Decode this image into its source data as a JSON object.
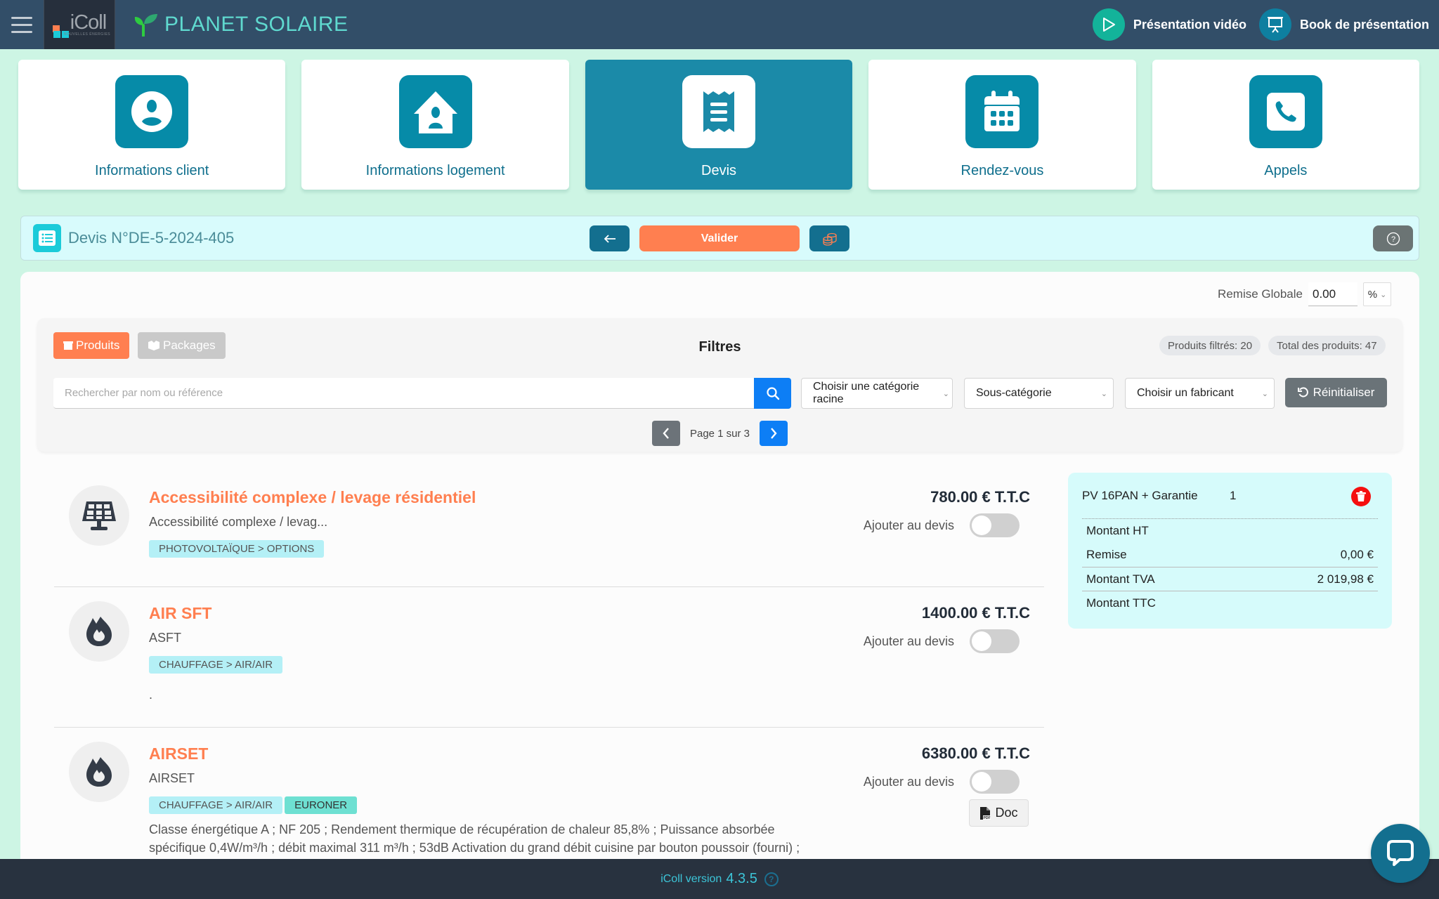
{
  "topbar": {
    "logo_text": "iColl",
    "logo_sub": "NOUVELLES ÉNERGIES",
    "brand_name": "PLANET SOLAIRE",
    "actions": [
      {
        "label": "Présentation vidéo",
        "icon": "play-icon",
        "color": "#13b39a"
      },
      {
        "label": "Book de présentation",
        "icon": "presentation-board-icon",
        "color": "#0e7fa0"
      }
    ]
  },
  "tiles": [
    {
      "label": "Informations client",
      "icon": "user-circle-icon",
      "active": false
    },
    {
      "label": "Informations logement",
      "icon": "house-user-icon",
      "active": false
    },
    {
      "label": "Devis",
      "icon": "receipt-icon",
      "active": true
    },
    {
      "label": "Rendez-vous",
      "icon": "calendar-icon",
      "active": false
    },
    {
      "label": "Appels",
      "icon": "phone-icon",
      "active": false
    }
  ],
  "devis_bar": {
    "title": "Devis N°DE-5-2024-405",
    "valider_label": "Valider",
    "back_icon": "arrow-left-icon",
    "coins_icon": "coins-icon",
    "help_icon": "question-circle-icon"
  },
  "remise": {
    "label": "Remise Globale",
    "value": "0.00",
    "unit": "%"
  },
  "filters": {
    "title": "Filtres",
    "tabs": [
      {
        "label": "Produits",
        "active": true
      },
      {
        "label": "Packages",
        "active": false
      }
    ],
    "filtered_count": "Produits filtrés: 20",
    "total_count": "Total des produits: 47",
    "search_placeholder": "Rechercher par nom ou référence",
    "search_value": "",
    "category_select": "Choisir une catégorie racine",
    "subcategory_select": "Sous-catégorie",
    "manufacturer_select": "Choisir un fabricant",
    "reset_label": "Réinitialiser",
    "pagination": {
      "text": "Page 1 sur 3",
      "current": 1,
      "total": 3
    }
  },
  "products": [
    {
      "name": "Accessibilité complexe / levage résidentiel",
      "ref": "Accessibilité complexe / levag...",
      "tags": [
        "PHOTOVOLTAÏQUE > OPTIONS"
      ],
      "brand": "",
      "description": "",
      "price": "780.00 € T.T.C",
      "add_label": "Ajouter au devis",
      "added": false,
      "icon": "solar-panel-icon",
      "has_doc": false
    },
    {
      "name": "AIR SFT",
      "ref": "ASFT",
      "tags": [
        "CHAUFFAGE > AIR/AIR"
      ],
      "brand": "",
      "description": ".",
      "price": "1400.00 € T.T.C",
      "add_label": "Ajouter au devis",
      "added": false,
      "icon": "fire-icon",
      "has_doc": false
    },
    {
      "name": "AIRSET",
      "ref": "AIRSET",
      "tags": [
        "CHAUFFAGE > AIR/AIR"
      ],
      "brand": "EURONER",
      "description": "Classe énergétique A ; NF 205 ; Rendement thermique de récupération de chaleur 85,8% ; Puissance absorbée spécifique 0,4W/m³/h ; débit maximal 311 m³/h ; 53dB Activation du grand débit cuisine par bouton poussoir (fourni) ; Caisson",
      "price": "6380.00 € T.T.C",
      "add_label": "Ajouter au devis",
      "added": false,
      "icon": "fire-icon",
      "has_doc": true,
      "doc_label": "Doc"
    }
  ],
  "summary": {
    "item_name": "PV 16PAN + Garantie",
    "item_qty": "1",
    "rows": [
      {
        "label": "Montant HT",
        "value": ""
      },
      {
        "label": "Remise",
        "value": "0,00 €"
      },
      {
        "label": "Montant TVA",
        "value": "2 019,98 €"
      },
      {
        "label": "Montant TTC",
        "value": ""
      }
    ]
  },
  "footer": {
    "label": "iColl version",
    "version": "4.3.5"
  },
  "colors": {
    "accent_orange": "#ff7f50",
    "teal": "#068ba8",
    "topbar": "#324e68",
    "background": "#cdf5e4"
  }
}
